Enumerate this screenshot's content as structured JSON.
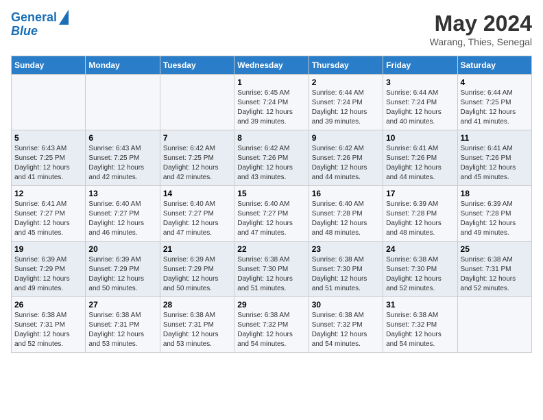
{
  "header": {
    "logo_line1": "General",
    "logo_line2": "Blue",
    "month_title": "May 2024",
    "location": "Warang, Thies, Senegal"
  },
  "days_of_week": [
    "Sunday",
    "Monday",
    "Tuesday",
    "Wednesday",
    "Thursday",
    "Friday",
    "Saturday"
  ],
  "weeks": [
    [
      {
        "day": "",
        "sunrise": "",
        "sunset": "",
        "daylight": ""
      },
      {
        "day": "",
        "sunrise": "",
        "sunset": "",
        "daylight": ""
      },
      {
        "day": "",
        "sunrise": "",
        "sunset": "",
        "daylight": ""
      },
      {
        "day": "1",
        "sunrise": "6:45 AM",
        "sunset": "7:24 PM",
        "daylight": "12 hours and 39 minutes."
      },
      {
        "day": "2",
        "sunrise": "6:44 AM",
        "sunset": "7:24 PM",
        "daylight": "12 hours and 39 minutes."
      },
      {
        "day": "3",
        "sunrise": "6:44 AM",
        "sunset": "7:24 PM",
        "daylight": "12 hours and 40 minutes."
      },
      {
        "day": "4",
        "sunrise": "6:44 AM",
        "sunset": "7:25 PM",
        "daylight": "12 hours and 41 minutes."
      }
    ],
    [
      {
        "day": "5",
        "sunrise": "6:43 AM",
        "sunset": "7:25 PM",
        "daylight": "12 hours and 41 minutes."
      },
      {
        "day": "6",
        "sunrise": "6:43 AM",
        "sunset": "7:25 PM",
        "daylight": "12 hours and 42 minutes."
      },
      {
        "day": "7",
        "sunrise": "6:42 AM",
        "sunset": "7:25 PM",
        "daylight": "12 hours and 42 minutes."
      },
      {
        "day": "8",
        "sunrise": "6:42 AM",
        "sunset": "7:26 PM",
        "daylight": "12 hours and 43 minutes."
      },
      {
        "day": "9",
        "sunrise": "6:42 AM",
        "sunset": "7:26 PM",
        "daylight": "12 hours and 44 minutes."
      },
      {
        "day": "10",
        "sunrise": "6:41 AM",
        "sunset": "7:26 PM",
        "daylight": "12 hours and 44 minutes."
      },
      {
        "day": "11",
        "sunrise": "6:41 AM",
        "sunset": "7:26 PM",
        "daylight": "12 hours and 45 minutes."
      }
    ],
    [
      {
        "day": "12",
        "sunrise": "6:41 AM",
        "sunset": "7:27 PM",
        "daylight": "12 hours and 45 minutes."
      },
      {
        "day": "13",
        "sunrise": "6:40 AM",
        "sunset": "7:27 PM",
        "daylight": "12 hours and 46 minutes."
      },
      {
        "day": "14",
        "sunrise": "6:40 AM",
        "sunset": "7:27 PM",
        "daylight": "12 hours and 47 minutes."
      },
      {
        "day": "15",
        "sunrise": "6:40 AM",
        "sunset": "7:27 PM",
        "daylight": "12 hours and 47 minutes."
      },
      {
        "day": "16",
        "sunrise": "6:40 AM",
        "sunset": "7:28 PM",
        "daylight": "12 hours and 48 minutes."
      },
      {
        "day": "17",
        "sunrise": "6:39 AM",
        "sunset": "7:28 PM",
        "daylight": "12 hours and 48 minutes."
      },
      {
        "day": "18",
        "sunrise": "6:39 AM",
        "sunset": "7:28 PM",
        "daylight": "12 hours and 49 minutes."
      }
    ],
    [
      {
        "day": "19",
        "sunrise": "6:39 AM",
        "sunset": "7:29 PM",
        "daylight": "12 hours and 49 minutes."
      },
      {
        "day": "20",
        "sunrise": "6:39 AM",
        "sunset": "7:29 PM",
        "daylight": "12 hours and 50 minutes."
      },
      {
        "day": "21",
        "sunrise": "6:39 AM",
        "sunset": "7:29 PM",
        "daylight": "12 hours and 50 minutes."
      },
      {
        "day": "22",
        "sunrise": "6:38 AM",
        "sunset": "7:30 PM",
        "daylight": "12 hours and 51 minutes."
      },
      {
        "day": "23",
        "sunrise": "6:38 AM",
        "sunset": "7:30 PM",
        "daylight": "12 hours and 51 minutes."
      },
      {
        "day": "24",
        "sunrise": "6:38 AM",
        "sunset": "7:30 PM",
        "daylight": "12 hours and 52 minutes."
      },
      {
        "day": "25",
        "sunrise": "6:38 AM",
        "sunset": "7:31 PM",
        "daylight": "12 hours and 52 minutes."
      }
    ],
    [
      {
        "day": "26",
        "sunrise": "6:38 AM",
        "sunset": "7:31 PM",
        "daylight": "12 hours and 52 minutes."
      },
      {
        "day": "27",
        "sunrise": "6:38 AM",
        "sunset": "7:31 PM",
        "daylight": "12 hours and 53 minutes."
      },
      {
        "day": "28",
        "sunrise": "6:38 AM",
        "sunset": "7:31 PM",
        "daylight": "12 hours and 53 minutes."
      },
      {
        "day": "29",
        "sunrise": "6:38 AM",
        "sunset": "7:32 PM",
        "daylight": "12 hours and 54 minutes."
      },
      {
        "day": "30",
        "sunrise": "6:38 AM",
        "sunset": "7:32 PM",
        "daylight": "12 hours and 54 minutes."
      },
      {
        "day": "31",
        "sunrise": "6:38 AM",
        "sunset": "7:32 PM",
        "daylight": "12 hours and 54 minutes."
      },
      {
        "day": "",
        "sunrise": "",
        "sunset": "",
        "daylight": ""
      }
    ]
  ]
}
